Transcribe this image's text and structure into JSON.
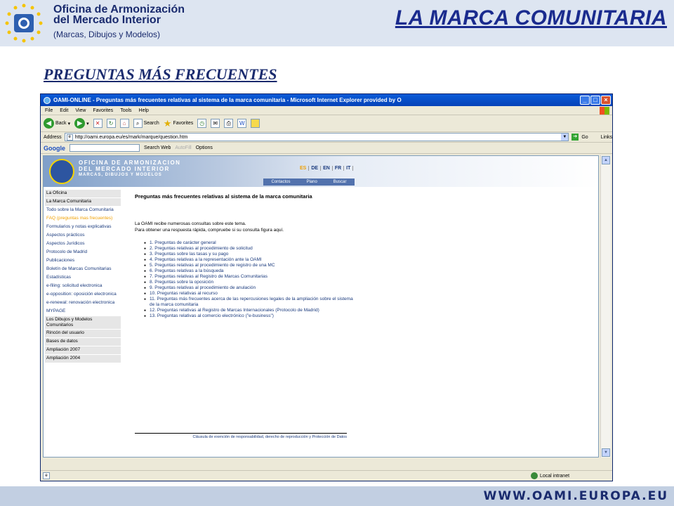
{
  "slide": {
    "org_name_1": "Oficina de Armonización",
    "org_name_2": "del Mercado Interior",
    "org_sub": "(Marcas, Dibujos y Modelos)",
    "title": "LA MARCA COMUNITARIA",
    "subtitle": "PREGUNTAS MÁS FRECUENTES",
    "footer_url": "WWW.OAMI.EUROPA.EU"
  },
  "browser": {
    "title": "OAMI-ONLINE - Preguntas más frecuentes relativas al sistema de la marca comunitaria - Microsoft Internet Explorer provided by O",
    "menu": [
      "File",
      "Edit",
      "View",
      "Favorites",
      "Tools",
      "Help"
    ],
    "toolbar": {
      "back": "Back",
      "search": "Search",
      "favorites": "Favorites"
    },
    "address_label": "Address",
    "address_url": "http://oami.europa.eu/es/mark/marque/question.htm",
    "go": "Go",
    "links": "Links",
    "google": {
      "logo": "Google",
      "search_web": "Search Web",
      "autofill": "AutoFill",
      "options": "Options"
    },
    "status_zone": "Local intranet"
  },
  "page": {
    "banner_text_1": "OFICINA DE ARMONIZACION",
    "banner_text_2": "DEL MERCADO INTERIOR",
    "banner_text_3": "MARCAS, DIBUJOS Y MODELOS",
    "languages": [
      "ES",
      "DE",
      "EN",
      "FR",
      "IT"
    ],
    "active_language": "ES",
    "banner_links": [
      "Contactos",
      "Plano",
      "Buscar"
    ],
    "sidebar": [
      {
        "label": "La Oficina",
        "style": "grey"
      },
      {
        "label": "La Marca Comunitaria",
        "style": "grey"
      },
      {
        "label": "Todo sobre la Marca Comunitaria",
        "style": "link"
      },
      {
        "label": "FAQ (preguntas mas frecuentes)",
        "style": "current"
      },
      {
        "label": "Formularios y notas explicativas",
        "style": "link"
      },
      {
        "label": "Aspectos prácticos",
        "style": "link"
      },
      {
        "label": "Aspectos Jurídicos",
        "style": "link"
      },
      {
        "label": "Protocolo de Madrid",
        "style": "link"
      },
      {
        "label": "Publicaciones",
        "style": "link"
      },
      {
        "label": "Boletín de Marcas Comunitarias",
        "style": "link"
      },
      {
        "label": "Estadísticas",
        "style": "link"
      },
      {
        "label": "e-filing: solicitud electronica",
        "style": "link"
      },
      {
        "label": "e-opposition: oposición electronica",
        "style": "link"
      },
      {
        "label": "e-renewal: renovación electronica",
        "style": "link"
      },
      {
        "label": "MYPAGE",
        "style": "link"
      },
      {
        "label": "Los Dibujos y Modelos Comunitarios",
        "style": "grey"
      },
      {
        "label": "Rincón del usuario",
        "style": "grey"
      },
      {
        "label": "Bases de datos",
        "style": "grey"
      },
      {
        "label": "Ampliación 2007",
        "style": "grey"
      },
      {
        "label": "Ampliación 2004",
        "style": "grey"
      }
    ],
    "faq_title": "Preguntas más frecuentes relativas al sistema de la marca comunitaria",
    "intro_1": "La OAMI recibe numerosas consultas sobre este tema.",
    "intro_2": "Para obtener una respuesta rápida, compruebe si su consulta figura aquí.",
    "questions": [
      "1. Preguntas de carácter general",
      "2. Preguntas relativas al procedimiento de solicitud",
      "3. Preguntas sobre las tasas y su pago",
      "4. Preguntas relativas a la representación ante la OAMI",
      "5. Preguntas relativas al procedimiento de registro de una MC",
      "6. Preguntas relativas a la búsqueda",
      "7. Preguntas relativas al Registro de Marcas Comunitarias",
      "8. Preguntas sobre la oposición",
      "9. Preguntas relativas al procedimiento de anulación",
      "10. Preguntas relativas al recurso",
      "11. Preguntas más frecuentes acerca de las repercusiones legales de la ampliación sobre el sistema de la marca comunitaria",
      "12. Preguntas relativas al Registro de Marcas Internacionales (Protocolo de Madrid)",
      "13. Preguntas relativas al comercio electrónico (\"e-business\")"
    ],
    "disclaimer": "Cláusula de exención de responsabilidad, derecho de reproducción y Protección de Datos"
  }
}
